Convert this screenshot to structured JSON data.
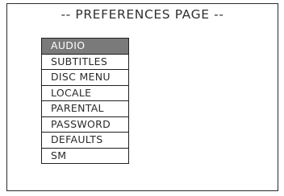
{
  "page": {
    "title": "-- PREFERENCES PAGE --"
  },
  "menu": {
    "selected_index": 0,
    "items": [
      {
        "label": "AUDIO"
      },
      {
        "label": "SUBTITLES"
      },
      {
        "label": "DISC MENU"
      },
      {
        "label": "LOCALE"
      },
      {
        "label": "PARENTAL"
      },
      {
        "label": "PASSWORD"
      },
      {
        "label": "DEFAULTS"
      },
      {
        "label": "SM"
      }
    ]
  },
  "colors": {
    "selected_background": "#7a7a7a",
    "selected_text": "#ffffff",
    "border": "#1f1f1f"
  }
}
